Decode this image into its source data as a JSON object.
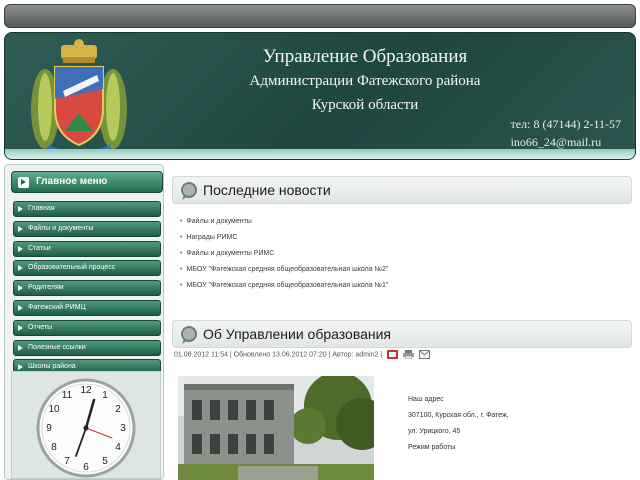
{
  "header": {
    "title_line1": "Управление Образования",
    "title_line2": "Администрации Фатежского района",
    "title_line3": "Курской области",
    "phone": "тел: 8 (47144) 2-11-57",
    "email": "ino66_24@mail.ru"
  },
  "sidebar": {
    "menu_title": "Главное меню",
    "items": [
      "Главная",
      "Файлы и документы",
      "Статьи",
      "Образовательный процесс",
      "Родителям",
      "Фатежский РИМЦ",
      "Отчеты",
      "Полезные ссылки",
      "Школы района"
    ]
  },
  "news": {
    "title": "Последние новости",
    "items": [
      "Файлы и документы",
      "Награды РИМС",
      "Файлы и документы РИМС",
      "МБОУ \"Фатежская средняя общеобразовательная школа №2\"",
      "МБОУ \"Фатежская средняя общеобразовательная школа №1\""
    ]
  },
  "about": {
    "title": "Об Управлении образования",
    "meta": "01.06.2012 11:54 | Обновлено 13.06.2012 07:20 | Автор: admin2 |",
    "address_lines": [
      "Наш адрес",
      "307100, Курская обл., г. Фатеж,",
      "ул. Урицкого, 45",
      "Режим работы"
    ]
  },
  "colors": {
    "header_bg": "#1f4640",
    "menu_green": "#246a52",
    "accent_red": "#c44444"
  },
  "icons": {
    "crest": "coat-of-arms-icon",
    "news_bubble": "speech-bubble-icon",
    "pdf": "pdf-icon",
    "print": "print-icon",
    "email": "email-icon"
  }
}
